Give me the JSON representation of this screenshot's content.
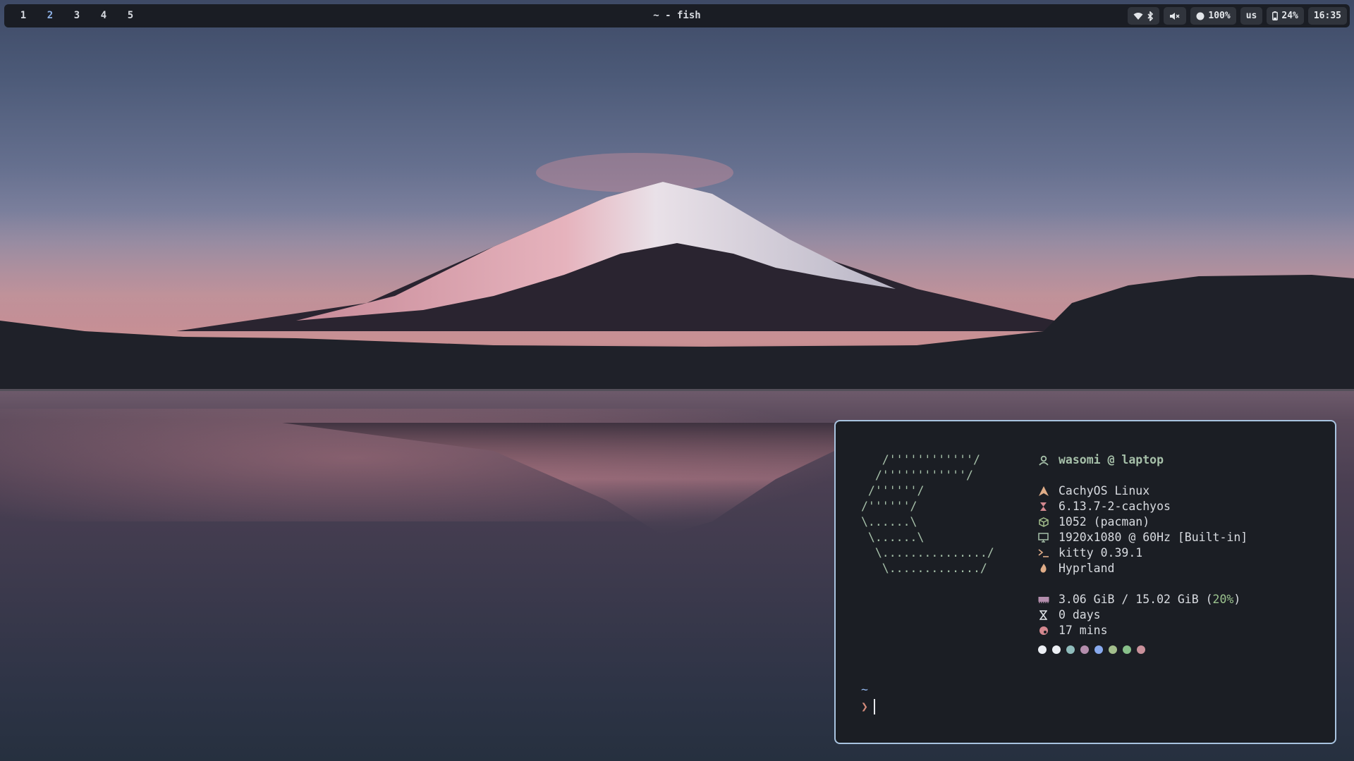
{
  "topbar": {
    "workspaces": [
      {
        "label": "1",
        "active": false
      },
      {
        "label": "2",
        "active": true
      },
      {
        "label": "3",
        "active": false
      },
      {
        "label": "4",
        "active": false
      },
      {
        "label": "5",
        "active": false
      }
    ],
    "window_title": "~ - fish",
    "tray": {
      "wifi_icon": "wifi-icon",
      "bluetooth_icon": "bluetooth-icon",
      "volume_icon": "volume-muted-icon",
      "brightness_value": "100%",
      "keyboard_layout": "us",
      "battery_value": "24%",
      "clock": "16:35"
    }
  },
  "terminal": {
    "ascii_logo": [
      "   /''''''''''''/",
      "  /''''''''''''/",
      " /''''''/",
      "/''''''/",
      "\\......\\",
      " \\......\\",
      "  \\.............../",
      "   \\............./"
    ],
    "fetch": {
      "user": "wasomi",
      "separator": "@",
      "host": "laptop",
      "os": "CachyOS Linux",
      "kernel": "6.13.7-2-cachyos",
      "packages": "1052 (pacman)",
      "display": "1920x1080 @ 60Hz [Built-in]",
      "terminal": "kitty 0.39.1",
      "wm": "Hyprland",
      "memory_used": "3.06 GiB / 15.02 GiB (",
      "memory_percent": "20%",
      "memory_close": ")",
      "uptime_days": "0 days",
      "uptime_mins": "17 mins"
    },
    "palette": [
      "#eceff4",
      "#eceff4",
      "#8fbcbb",
      "#b48ead",
      "#88aaee",
      "#a3be8c",
      "#88c08a",
      "#c9919b"
    ],
    "prompt_dir": "~",
    "prompt_symbol": "❯"
  },
  "colors": {
    "accent": "#8fb3e8",
    "terminal_border": "#a9c4e0",
    "ascii": "#a6c0a9",
    "bar_bg": "#1a1d24"
  }
}
